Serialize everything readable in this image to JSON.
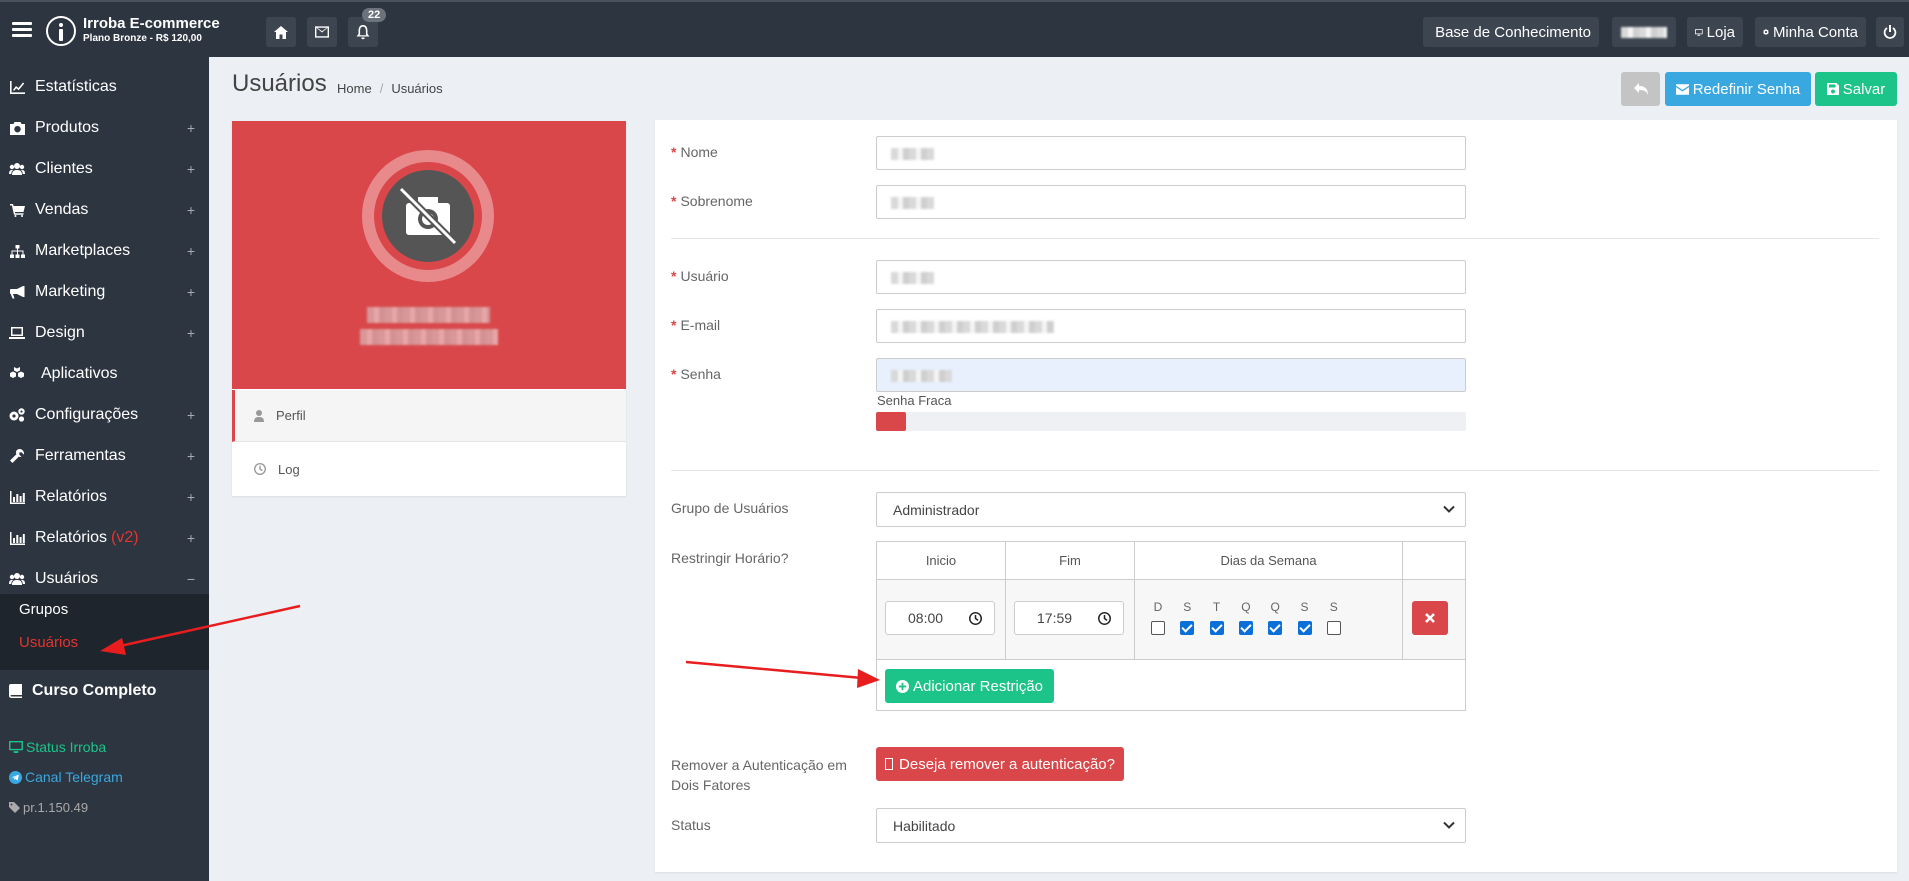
{
  "header": {
    "brand_title": "Irroba E-commerce",
    "brand_plan": "Plano Bronze - R$ 120,00",
    "notifications_count": "22",
    "knowledge_base": "Base de Conhecimento",
    "store": "Loja",
    "account": "Minha Conta"
  },
  "sidebar": {
    "items": [
      {
        "label": "Estatísticas",
        "icon": "chart-line-icon",
        "expandable": false
      },
      {
        "label": "Produtos",
        "icon": "camera-icon",
        "expandable": true
      },
      {
        "label": "Clientes",
        "icon": "users-icon",
        "expandable": true
      },
      {
        "label": "Vendas",
        "icon": "cart-icon",
        "expandable": true
      },
      {
        "label": "Marketplaces",
        "icon": "sitemap-icon",
        "expandable": true
      },
      {
        "label": "Marketing",
        "icon": "bullhorn-icon",
        "expandable": true
      },
      {
        "label": "Design",
        "icon": "laptop-icon",
        "expandable": true
      },
      {
        "label": "Aplicativos",
        "icon": "cubes-icon",
        "expandable": false
      },
      {
        "label": "Configurações",
        "icon": "cogs-icon",
        "expandable": true
      },
      {
        "label": "Ferramentas",
        "icon": "wrench-icon",
        "expandable": true
      },
      {
        "label": "Relatórios",
        "icon": "bar-chart-icon",
        "expandable": true
      },
      {
        "label": "Relatórios",
        "suffix": "(v2)",
        "icon": "bar-chart-icon",
        "expandable": true
      },
      {
        "label": "Usuários",
        "icon": "users-icon",
        "expandable": true,
        "expanded": true
      }
    ],
    "submenu": [
      {
        "label": "Grupos",
        "active": false
      },
      {
        "label": "Usuários",
        "active": true
      }
    ],
    "course": "Curso Completo",
    "status_link": "Status Irroba",
    "telegram_link": "Canal Telegram",
    "version": "pr.1.150.49"
  },
  "page": {
    "title": "Usuários",
    "breadcrumb": [
      "Home",
      "Usuários"
    ],
    "buttons": {
      "reset_password": "Redefinir Senha",
      "save": "Salvar"
    }
  },
  "profile_card": {
    "tabs": [
      "Perfil",
      "Log"
    ]
  },
  "form": {
    "name_label": "Nome",
    "surname_label": "Sobrenome",
    "username_label": "Usuário",
    "email_label": "E-mail",
    "password_label": "Senha",
    "password_strength": "Senha Fraca",
    "password_strength_value": 0.05,
    "group_label": "Grupo de Usuários",
    "group_value": "Administrador",
    "restrict_label": "Restringir Horário?",
    "schedule": {
      "col_start": "Inicio",
      "col_end": "Fim",
      "col_days": "Dias da Semana",
      "start": "08:00",
      "end": "17:59",
      "days": [
        {
          "letter": "D",
          "checked": false
        },
        {
          "letter": "S",
          "checked": true
        },
        {
          "letter": "T",
          "checked": true
        },
        {
          "letter": "Q",
          "checked": true
        },
        {
          "letter": "Q",
          "checked": true
        },
        {
          "letter": "S",
          "checked": true
        },
        {
          "letter": "S",
          "checked": false
        }
      ],
      "add_button": "Adicionar Restrição"
    },
    "twofa_label": "Remover a Autenticação em Dois Fatores",
    "twofa_button": "Deseja remover a autenticação?",
    "status_label": "Status",
    "status_value": "Habilitado"
  },
  "colors": {
    "accent_red": "#d9474a",
    "blue_button": "#3aa8e0",
    "green_button": "#1cc48a",
    "sidebar_bg": "#2d3540"
  }
}
